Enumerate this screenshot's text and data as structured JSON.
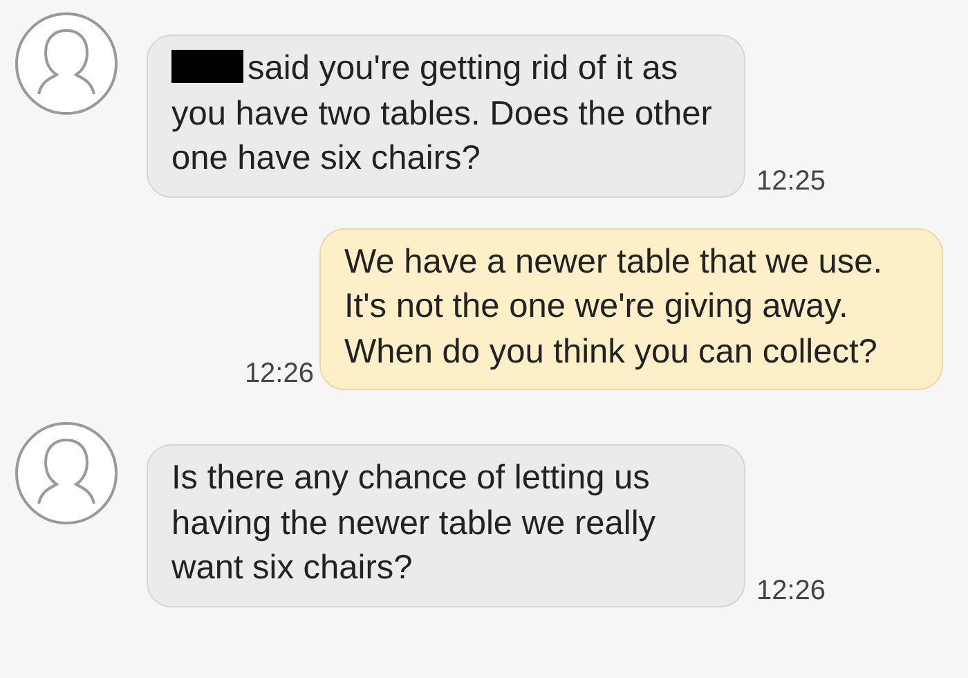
{
  "messages": [
    {
      "kind": "incoming",
      "redacted_name": true,
      "text": "said you're getting rid of it as you have two tables. Does the other one have six chairs?",
      "time": "12:25"
    },
    {
      "kind": "outgoing",
      "redacted_name": false,
      "text": "We have a newer table that we use. It's not the one we're giving away. When do you think you can collect?",
      "time": "12:26"
    },
    {
      "kind": "incoming",
      "redacted_name": false,
      "text": "Is there any chance of letting us having the newer table we really want six chairs?",
      "time": "12:26"
    }
  ]
}
